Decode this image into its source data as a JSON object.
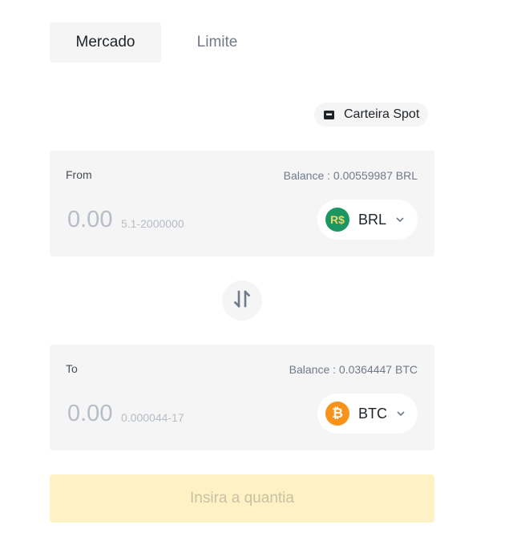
{
  "tabs": [
    {
      "label": "Mercado",
      "active": true
    },
    {
      "label": "Limite",
      "active": false
    }
  ],
  "wallet": {
    "label": "Carteira Spot",
    "icon": "wallet-icon"
  },
  "from": {
    "label": "From",
    "balance": "Balance : 0.00559987 BRL",
    "placeholder": "0.00",
    "range": "5.1-2000000",
    "coin": {
      "code": "BRL",
      "icon_text": "R$",
      "icon": "brl-coin-icon",
      "color": "#1c9762",
      "text_color": "#f0d46a"
    }
  },
  "swap": {
    "icon": "swap-arrows-icon"
  },
  "to": {
    "label": "To",
    "balance": "Balance : 0.0364447 BTC",
    "placeholder": "0.00",
    "range": "0.000044-17",
    "coin": {
      "code": "BTC",
      "icon_text": "₿",
      "icon": "btc-coin-icon",
      "color": "#f7931a",
      "text_color": "#ffffff"
    }
  },
  "submit": {
    "label": "Insira a quantia",
    "disabled": true
  },
  "colors": {
    "accent_disabled": "#fef1c3",
    "card_bg": "#f5f5f5",
    "text_primary": "#1e2329",
    "text_secondary": "#707a8a",
    "placeholder": "#b7bdc6"
  }
}
